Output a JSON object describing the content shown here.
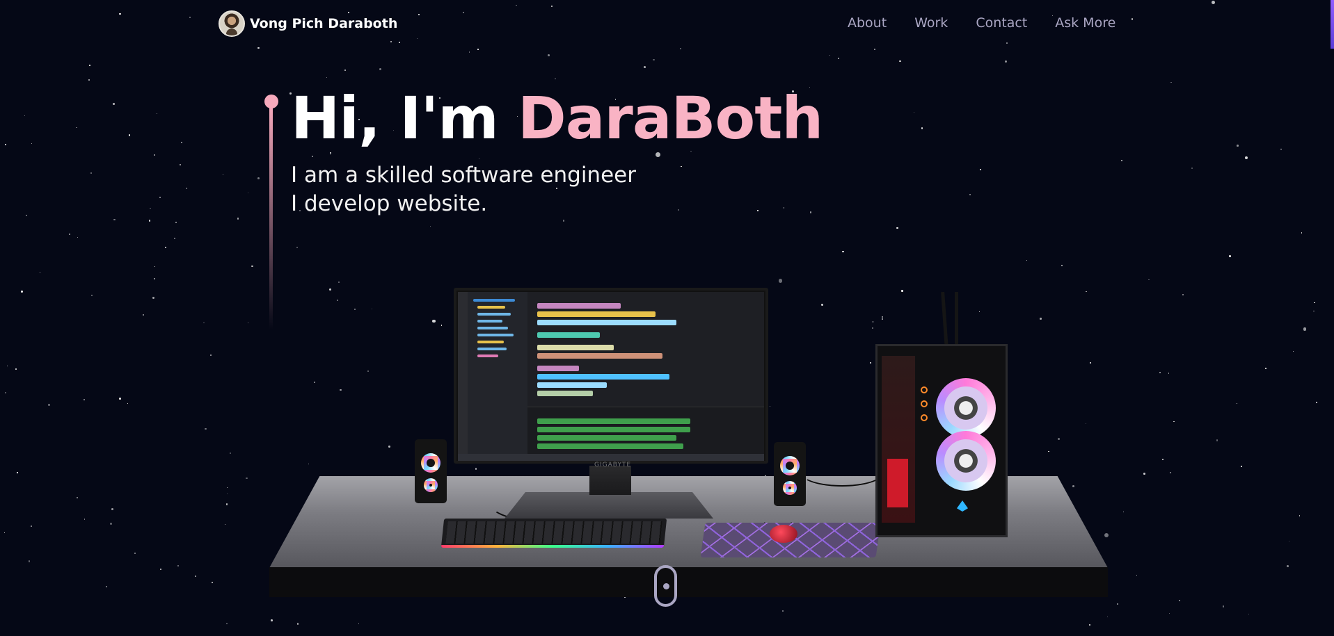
{
  "nav": {
    "brand_name": "Vong Pich Daraboth",
    "links": [
      {
        "label": "About"
      },
      {
        "label": "Work"
      },
      {
        "label": "Contact"
      },
      {
        "label": "Ask More"
      }
    ]
  },
  "hero": {
    "greeting": "Hi, I'm ",
    "name": "DaraBoth",
    "subtitle_line1": "I am a skilled software engineer",
    "subtitle_line2": "I develop website."
  },
  "scene": {
    "monitor_brand": "GIGABYTE"
  },
  "colors": {
    "background": "#050816",
    "accent_pink": "#f9b3c4",
    "nav_link": "#aaa6c3",
    "scrollbar_accent": "#915eff"
  },
  "icons": {
    "scroll_indicator": "mouse-scroll-icon",
    "avatar": "profile-avatar"
  }
}
